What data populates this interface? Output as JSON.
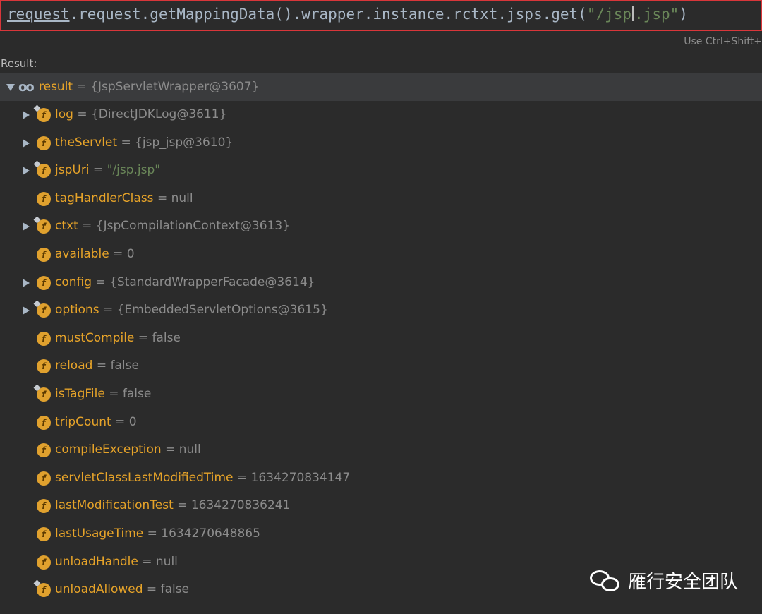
{
  "expression": {
    "part_kw": "request",
    "part_mid": ".request.getMappingData().wrapper.instance.rctxt.jsps.get(",
    "part_str1": "\"/jsp",
    "part_str2": ".jsp\"",
    "part_end": ")"
  },
  "hint": "Use Ctrl+Shift+",
  "result_label": "Result:",
  "root": {
    "name": "result",
    "eq": " = ",
    "value": "{JspServletWrapper@3607}"
  },
  "fields": [
    {
      "name": "log",
      "value": "{DirectJDKLog@3611}",
      "kind": "ref",
      "expandable": true,
      "pin": true
    },
    {
      "name": "theServlet",
      "value": "{jsp_jsp@3610}",
      "kind": "ref",
      "expandable": true,
      "pin": false
    },
    {
      "name": "jspUri",
      "value": "\"/jsp.jsp\"",
      "kind": "str",
      "expandable": true,
      "pin": true
    },
    {
      "name": "tagHandlerClass",
      "value": "null",
      "kind": "plain",
      "expandable": false,
      "pin": false
    },
    {
      "name": "ctxt",
      "value": "{JspCompilationContext@3613}",
      "kind": "ref",
      "expandable": true,
      "pin": true
    },
    {
      "name": "available",
      "value": "0",
      "kind": "plain",
      "expandable": false,
      "pin": false
    },
    {
      "name": "config",
      "value": "{StandardWrapperFacade@3614}",
      "kind": "ref",
      "expandable": true,
      "pin": false
    },
    {
      "name": "options",
      "value": "{EmbeddedServletOptions@3615}",
      "kind": "ref",
      "expandable": true,
      "pin": true
    },
    {
      "name": "mustCompile",
      "value": "false",
      "kind": "plain",
      "expandable": false,
      "pin": false
    },
    {
      "name": "reload",
      "value": "false",
      "kind": "plain",
      "expandable": false,
      "pin": false
    },
    {
      "name": "isTagFile",
      "value": "false",
      "kind": "plain",
      "expandable": false,
      "pin": true
    },
    {
      "name": "tripCount",
      "value": "0",
      "kind": "plain",
      "expandable": false,
      "pin": false
    },
    {
      "name": "compileException",
      "value": "null",
      "kind": "plain",
      "expandable": false,
      "pin": false
    },
    {
      "name": "servletClassLastModifiedTime",
      "value": "1634270834147",
      "kind": "plain",
      "expandable": false,
      "pin": false
    },
    {
      "name": "lastModificationTest",
      "value": "1634270836241",
      "kind": "plain",
      "expandable": false,
      "pin": false
    },
    {
      "name": "lastUsageTime",
      "value": "1634270648865",
      "kind": "plain",
      "expandable": false,
      "pin": false
    },
    {
      "name": "unloadHandle",
      "value": "null",
      "kind": "plain",
      "expandable": false,
      "pin": false
    },
    {
      "name": "unloadAllowed",
      "value": "false",
      "kind": "plain",
      "expandable": false,
      "pin": true
    }
  ],
  "watermark": "雁行安全团队",
  "colors": {
    "field_name": "#e6a329",
    "string_value": "#6a8759",
    "highlight_border": "#d9363a",
    "background": "#2b2b2b"
  }
}
